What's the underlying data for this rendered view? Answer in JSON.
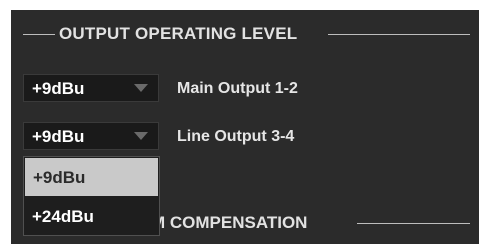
{
  "section1": {
    "title": "OUTPUT OPERATING LEVEL"
  },
  "rows": [
    {
      "value": "+9dBu",
      "label": "Main Output 1-2"
    },
    {
      "value": "+9dBu",
      "label": "Line Output 3-4"
    }
  ],
  "dropdown": {
    "options": [
      {
        "label": "+9dBu",
        "selected": true
      },
      {
        "label": "+24dBu",
        "selected": false
      }
    ]
  },
  "section2": {
    "title_visible": "M COMPENSATION"
  },
  "colors": {
    "panel_bg": "#2b2b2b",
    "select_bg": "#1a1a1a",
    "highlight": "#c9c9c9",
    "text": "#ffffff"
  },
  "icons": {
    "select_caret": "chevron-down-icon"
  }
}
